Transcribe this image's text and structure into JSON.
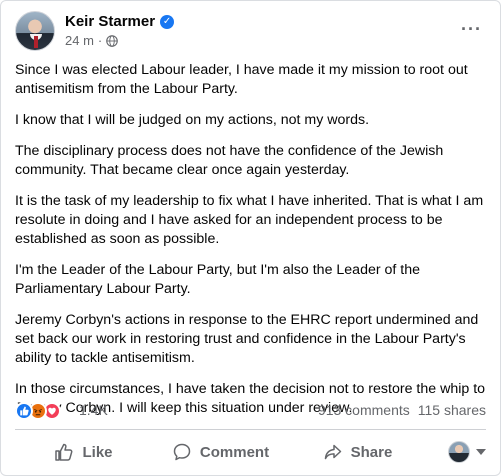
{
  "post": {
    "author": "Keir Starmer",
    "timestamp": "24 m",
    "separator": "·",
    "more_label": "···",
    "paragraphs": [
      "Since I was elected Labour leader, I have made it my mission to root out antisemitism from the Labour Party.",
      "I know that I will be judged on my actions, not my words.",
      "The disciplinary process does not have the confidence of the Jewish community. That became clear once again yesterday.",
      "It is the task of my leadership to fix what I have inherited. That is what I am resolute in doing and I have asked for an independent process to be established as soon as possible.",
      "I'm the Leader of the Labour Party, but I'm also the Leader of the Parliamentary Labour Party.",
      "Jeremy Corbyn's actions in response to the EHRC report undermined and set back our work in restoring trust and confidence in the Labour Party's ability to tackle antisemitism.",
      "In those circumstances, I have taken the decision not to restore the whip to Jeremy Corbyn. I will keep this situation under review."
    ]
  },
  "engagement": {
    "reaction_count": "1.4K",
    "comments": "913 comments",
    "shares": "115 shares",
    "reaction_icons": [
      "like-icon",
      "angry-icon",
      "love-icon"
    ]
  },
  "actions": {
    "like_label": "Like",
    "comment_label": "Comment",
    "share_label": "Share"
  },
  "colors": {
    "accent": "#1877f2",
    "secondary_text": "#65676b"
  }
}
